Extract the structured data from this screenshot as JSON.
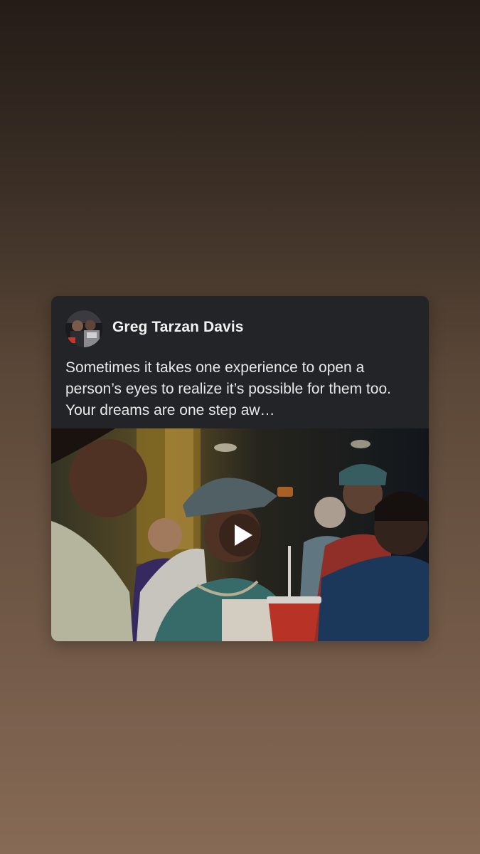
{
  "post": {
    "author_name": "Greg Tarzan Davis",
    "caption": "Sometimes it takes one experience to open a person’s eyes to realize it’s possible for them too. Your dreams are one step aw…",
    "avatar_icon": "profile-photo-icon",
    "media": {
      "type": "video",
      "play_icon": "play-icon"
    }
  },
  "colors": {
    "card_background": "#232427",
    "text_primary": "#f2f2f2",
    "background_top": "#241c17",
    "background_bottom": "#866a55"
  }
}
